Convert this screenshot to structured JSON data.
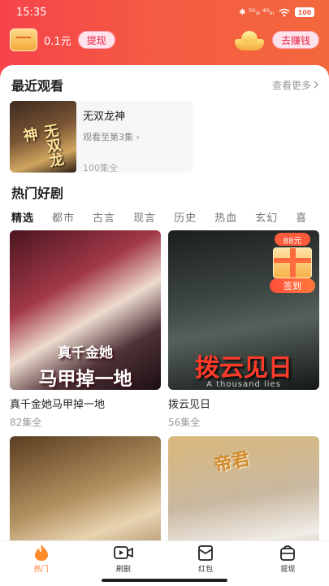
{
  "status_bar": {
    "time": "15:35",
    "icons_text": "✱ ⁵ᴳᵢₗₗ ⁴ᴳᵢₗₗ",
    "battery": "100"
  },
  "wallet": {
    "amount": "0.1元",
    "withdraw_label": "提现",
    "earn_label": "去赚钱"
  },
  "recent": {
    "title": "最近观看",
    "see_more": "查看更多",
    "item": {
      "name": "无双龙神",
      "progress": "观看至第3集",
      "episodes": "100集全",
      "poster_text": "无双龙神"
    }
  },
  "hot": {
    "title": "热门好剧",
    "tabs": [
      "精选",
      "都市",
      "古言",
      "现言",
      "历史",
      "热血",
      "玄幻",
      "喜"
    ],
    "active_tab": 0,
    "cards": [
      {
        "title": "真千金她马甲掉一地",
        "episodes": "82集全",
        "poster_l1": "真千金她",
        "poster_l2": "马甲掉一地"
      },
      {
        "title": "拨云见日",
        "episodes": "56集全",
        "poster_l1": "拨云见日",
        "poster_l2": "A thousand lies"
      },
      {
        "title": "",
        "episodes": ""
      },
      {
        "title": "",
        "episodes": "",
        "poster_l1": "帝君"
      }
    ]
  },
  "gift": {
    "amount": "88元",
    "label": "签到"
  },
  "nav": [
    {
      "label": "热门",
      "icon": "fire-icon",
      "active": true
    },
    {
      "label": "刷剧",
      "icon": "video-icon",
      "active": false
    },
    {
      "label": "红包",
      "icon": "red-envelope-icon",
      "active": false
    },
    {
      "label": "提现",
      "icon": "wallet-icon",
      "active": false
    }
  ],
  "colors": {
    "accent": "#f45a44",
    "active_nav": "#ff7a2a",
    "pill_text": "#e6244b"
  }
}
